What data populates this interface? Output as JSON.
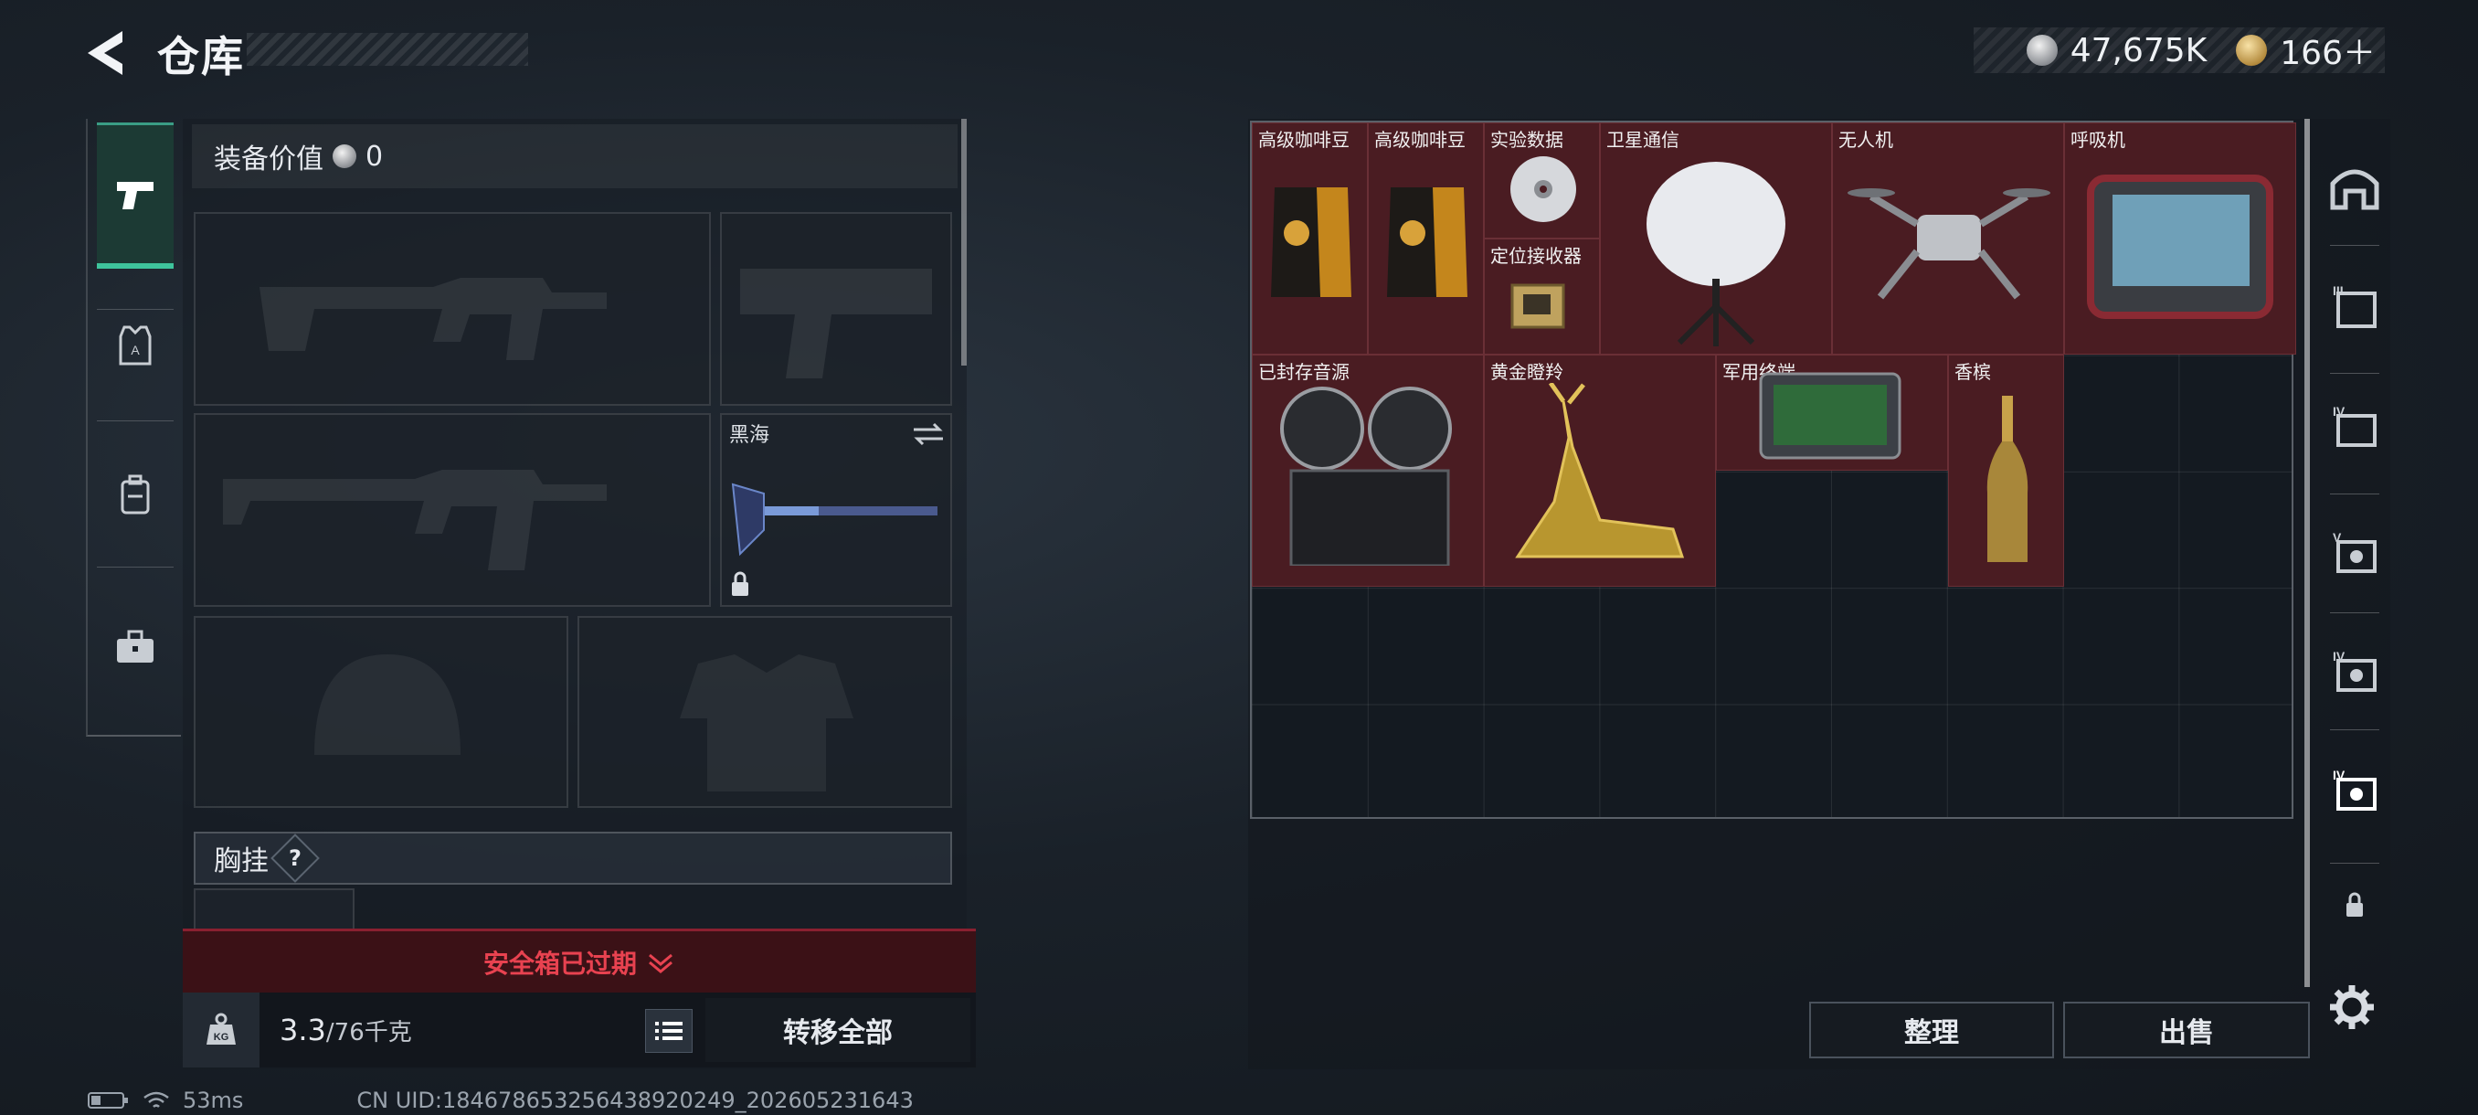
{
  "header": {
    "title": "仓库"
  },
  "currency": {
    "silver_value": "47,675K",
    "gold_value": "166＋"
  },
  "equipment": {
    "value_label": "装备价值",
    "value": "0",
    "melee_name": "黑海",
    "vest_label": "胸挂",
    "vest_help": "?"
  },
  "safebox": {
    "status": "安全箱已过期"
  },
  "bottom": {
    "weight_current": "3.3",
    "weight_max": "/76千克",
    "transfer_all": "转移全部"
  },
  "storage": {
    "items": [
      {
        "label": "高级咖啡豆"
      },
      {
        "label": "高级咖啡豆"
      },
      {
        "label": "实验数据"
      },
      {
        "label": "定位接收器"
      },
      {
        "label": "卫星通信"
      },
      {
        "label": "无人机"
      },
      {
        "label": "呼吸机"
      },
      {
        "label": "已封存音源"
      },
      {
        "label": "黄金瞪羚"
      },
      {
        "label": "军用终端"
      },
      {
        "label": "香槟"
      }
    ],
    "sort_label": "整理",
    "sell_label": "出售"
  },
  "status_bar": {
    "ping": "53ms",
    "uid": "CN UID:184678653256438920249_202605231643"
  },
  "icons": {
    "back": "chevron-left-icon",
    "silver_coin": "silver-coin-icon",
    "gold_coin": "gold-coin-icon",
    "left_nav": [
      "pistol-icon",
      "armor-vest-icon",
      "backpack-icon",
      "briefcase-icon"
    ],
    "right_nav": [
      "storage-home-icon",
      "case-tier-3-icon",
      "case-tier-4-icon",
      "case-tier-5-icon",
      "case-tier-4b-icon",
      "case-tier-4c-icon",
      "lock-icon"
    ],
    "settings": "gear-icon"
  },
  "colors": {
    "accent_green": "#3ec49c",
    "warning_red": "#e84250",
    "item_bg": "#4a1c22"
  }
}
